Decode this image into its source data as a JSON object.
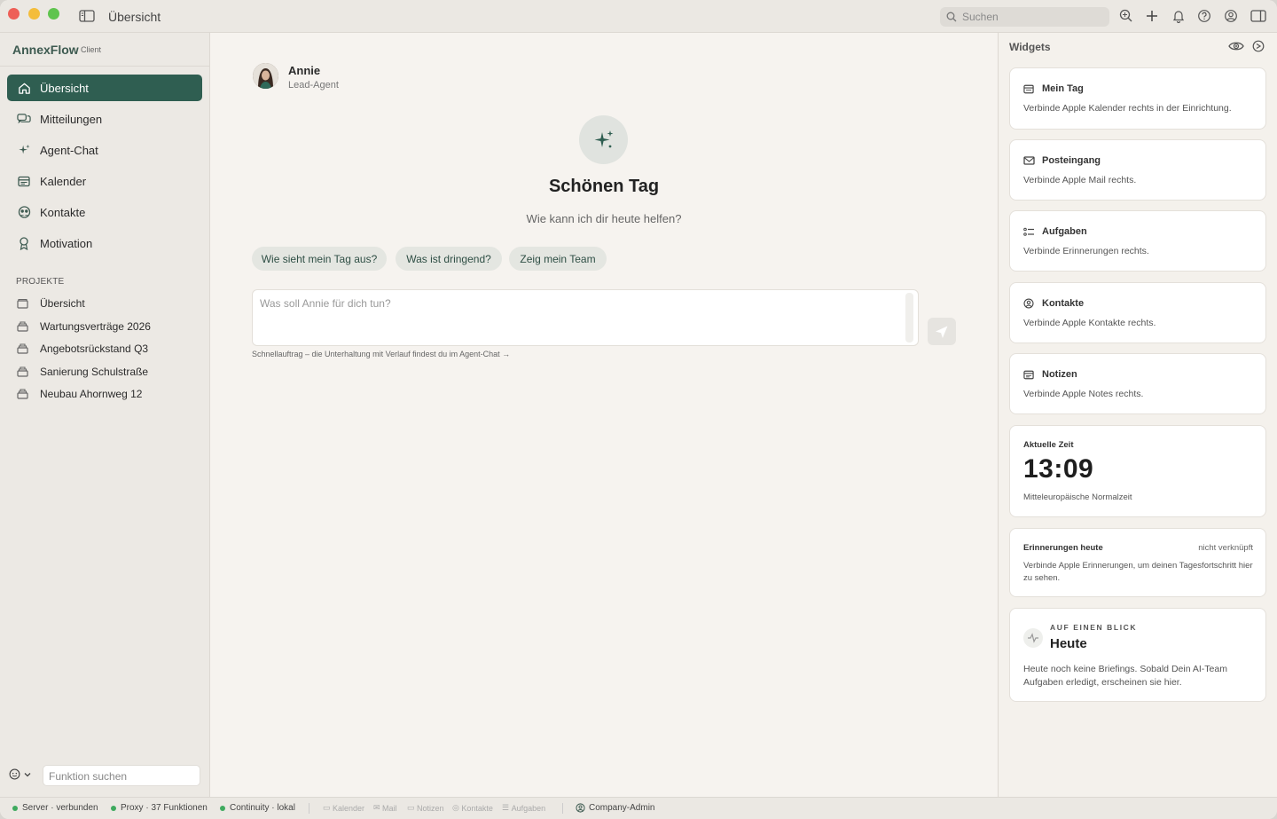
{
  "titlebar": {
    "title": "Übersicht",
    "search_placeholder": "Suchen"
  },
  "sidebar": {
    "brand": "AnnexFlow",
    "brand_tag": "Client",
    "nav": [
      {
        "label": "Übersicht",
        "icon": "home-icon",
        "active": true
      },
      {
        "label": "Mitteilungen",
        "icon": "chat-bubbles-icon"
      },
      {
        "label": "Agent-Chat",
        "icon": "sparkle-icon"
      },
      {
        "label": "Kalender",
        "icon": "calendar-icon"
      },
      {
        "label": "Kontakte",
        "icon": "contacts-icon"
      },
      {
        "label": "Motivation",
        "icon": "ribbon-icon"
      }
    ],
    "projects_label": "PROJEKTE",
    "projects": [
      {
        "label": "Übersicht",
        "icon": "folder-icon"
      },
      {
        "label": "Wartungsverträge 2026",
        "icon": "stack-icon"
      },
      {
        "label": "Angebotsrückstand Q3",
        "icon": "stack-icon"
      },
      {
        "label": "Sanierung Schulstraße",
        "icon": "stack-icon"
      },
      {
        "label": "Neubau Ahornweg 12",
        "icon": "stack-icon"
      }
    ],
    "function_search_placeholder": "Funktion suchen"
  },
  "main": {
    "agent_name": "Annie",
    "agent_role": "Lead-Agent",
    "greeting": "Schönen Tag",
    "subgreeting": "Wie kann ich dir heute helfen?",
    "chips": [
      "Wie sieht mein Tag aus?",
      "Was ist dringend?",
      "Zeig mein Team"
    ],
    "prompt_placeholder": "Was soll Annie für dich tun?",
    "hint": "Schnellauftrag – die Unterhaltung mit Verlauf findest du im Agent-Chat →"
  },
  "widgets": {
    "title": "Widgets",
    "cards": [
      {
        "title": "Mein Tag",
        "text": "Verbinde Apple Kalender rechts in der Einrichtung.",
        "icon": "calendar-icon"
      },
      {
        "title": "Posteingang",
        "text": "Verbinde Apple Mail rechts.",
        "icon": "mail-icon"
      },
      {
        "title": "Aufgaben",
        "text": "Verbinde Erinnerungen rechts.",
        "icon": "checklist-icon"
      },
      {
        "title": "Kontakte",
        "text": "Verbinde Apple Kontakte rechts.",
        "icon": "person-circle-icon"
      },
      {
        "title": "Notizen",
        "text": "Verbinde Apple Notes rechts.",
        "icon": "notes-icon"
      }
    ],
    "clock": {
      "label": "Aktuelle Zeit",
      "time": "13:09",
      "timezone": "Mitteleuropäische Normalzeit"
    },
    "reminders": {
      "label": "Erinnerungen heute",
      "state": "nicht verknüpft",
      "text": "Verbinde Apple Erinnerungen, um deinen Tagesfortschritt hier zu sehen."
    },
    "glance": {
      "kicker": "AUF EINEN BLICK",
      "title": "Heute",
      "text": "Heute noch keine Briefings. Sobald Dein AI-Team Aufgaben erledigt, erscheinen sie hier."
    }
  },
  "statusbar": {
    "server": "Server · verbunden",
    "proxy": "Proxy · 37 Funktionen",
    "continuity": "Continuity · lokal",
    "apps": [
      "Kalender",
      "Mail",
      "Notizen",
      "Kontakte",
      "Aufgaben"
    ],
    "role": "Company-Admin"
  },
  "colors": {
    "accent": "#2f5e51",
    "status_green": "#3faa5f"
  }
}
